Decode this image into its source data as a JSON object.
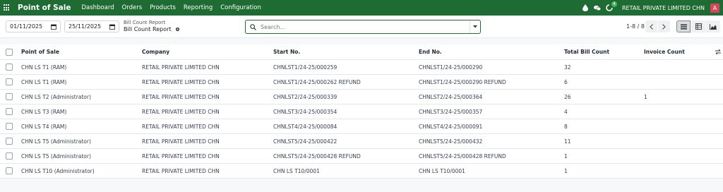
{
  "navbar": {
    "app_title": "Point of Sale",
    "menu": [
      "Dashboard",
      "Orders",
      "Products",
      "Reporting",
      "Configuration"
    ],
    "company": "RETAIL PRIVATE LIMITED CHN",
    "avatar_letter": "A",
    "activity_count": "4",
    "accent_color": "#1f6b34"
  },
  "control": {
    "date_from": "01/11/2025",
    "date_to": "25/11/2025",
    "breadcrumb": "Bill Count Report",
    "title": "Bill Count Report",
    "search_placeholder": "Search...",
    "pager": "1-8 / 8"
  },
  "table": {
    "headers": [
      "Point of Sale",
      "Company",
      "Start No.",
      "End No.",
      "Total Bill Count",
      "Invoice Count"
    ],
    "rows": [
      [
        "CHN LS T1 (RAM)",
        "RETAIL PRIVATE LIMITED CHN",
        "CHNLST1/24-25/000259",
        "CHNLST1/24-25/000290",
        "32",
        ""
      ],
      [
        "CHN LS T1 (RAM)",
        "RETAIL PRIVATE LIMITED CHN",
        "CHNLST1/24-25/000262 REFUND",
        "CHNLST1/24-25/000290 REFUND",
        "6",
        ""
      ],
      [
        "CHN LS T2 (Administrator)",
        "RETAIL PRIVATE LIMITED CHN",
        "CHNLST2/24-25/000339",
        "CHNLST2/24-25/000364",
        "26",
        "1"
      ],
      [
        "CHN LS T3 (RAM)",
        "RETAIL PRIVATE LIMITED CHN",
        "CHNLST3/24-25/000354",
        "CHNLST3/24-25/000357",
        "4",
        ""
      ],
      [
        "CHN LS T4 (RAM)",
        "RETAIL PRIVATE LIMITED CHN",
        "CHNLST4/24-25/000084",
        "CHNLST4/24-25/000091",
        "8",
        ""
      ],
      [
        "CHN LS T5 (Administrator)",
        "RETAIL PRIVATE LIMITED CHN",
        "CHNLST5/24-25/000422",
        "CHNLST5/24-25/000432",
        "11",
        ""
      ],
      [
        "CHN LS T5 (Administrator)",
        "RETAIL PRIVATE LIMITED CHN",
        "CHNLST5/24-25/000428 REFUND",
        "CHNLST5/24-25/000428 REFUND",
        "1",
        ""
      ],
      [
        "CHN LS T10 (Administrator)",
        "RETAIL PRIVATE LIMITED CHN",
        "CHN LS T10/0001",
        "CHN LS T10/0001",
        "1",
        ""
      ]
    ]
  }
}
